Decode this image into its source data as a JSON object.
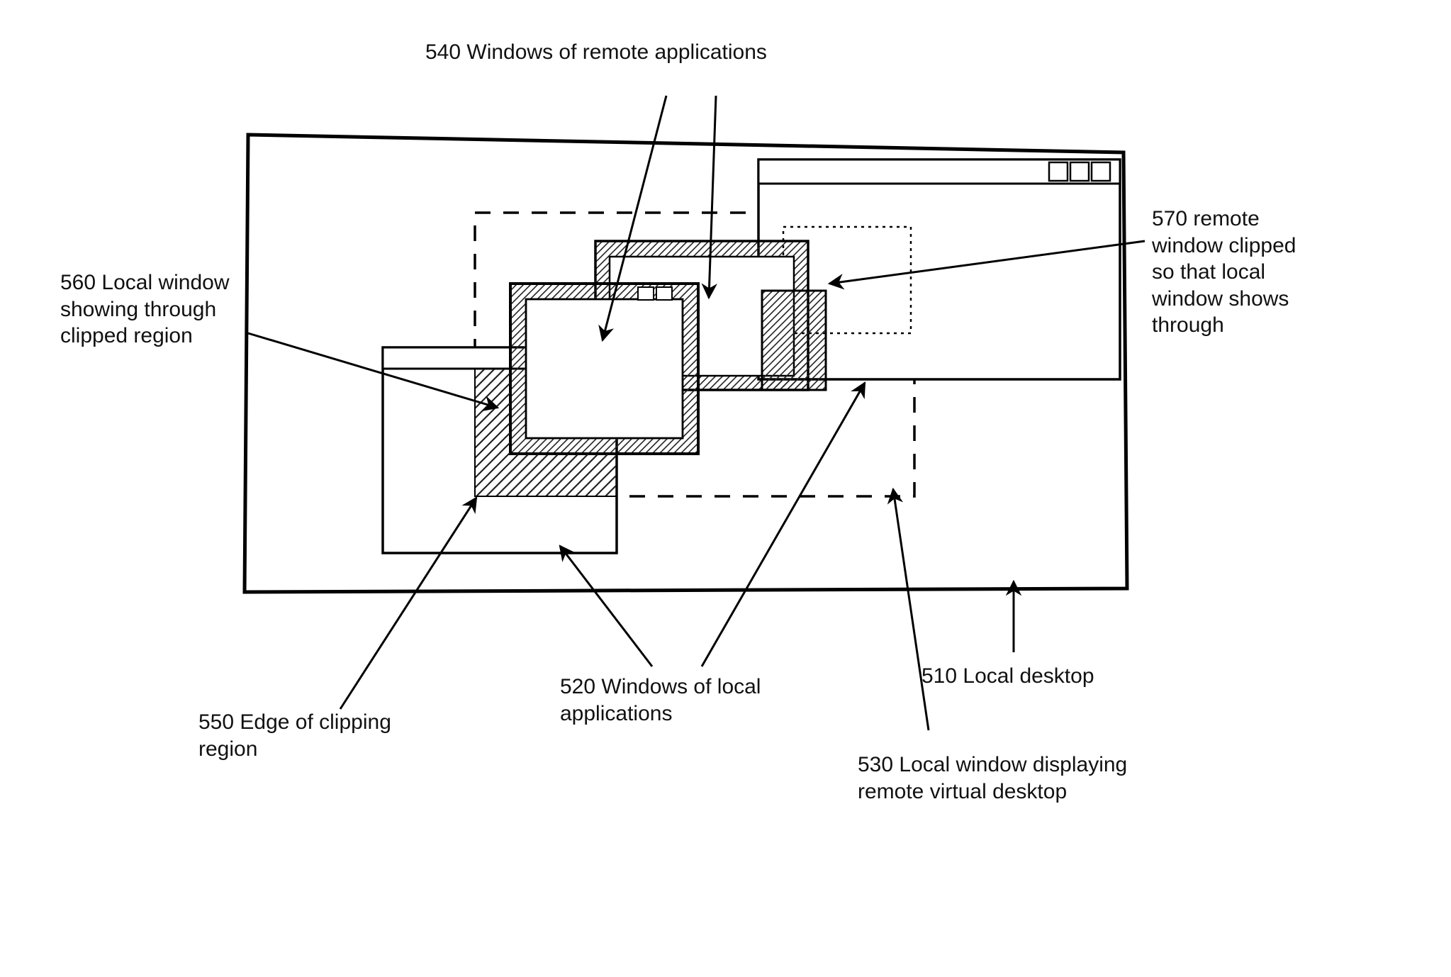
{
  "labels": {
    "l540": "540  Windows of remote applications",
    "l560": "560  Local window\nshowing through\nclipped region",
    "l570": "570 remote\nwindow clipped\nso that local\nwindow shows\nthrough",
    "l550": "550  Edge of clipping\n        region",
    "l520": "520 Windows of local\n        applications",
    "l510": "510  Local desktop",
    "l530": "530 Local window displaying\n        remote virtual desktop"
  }
}
